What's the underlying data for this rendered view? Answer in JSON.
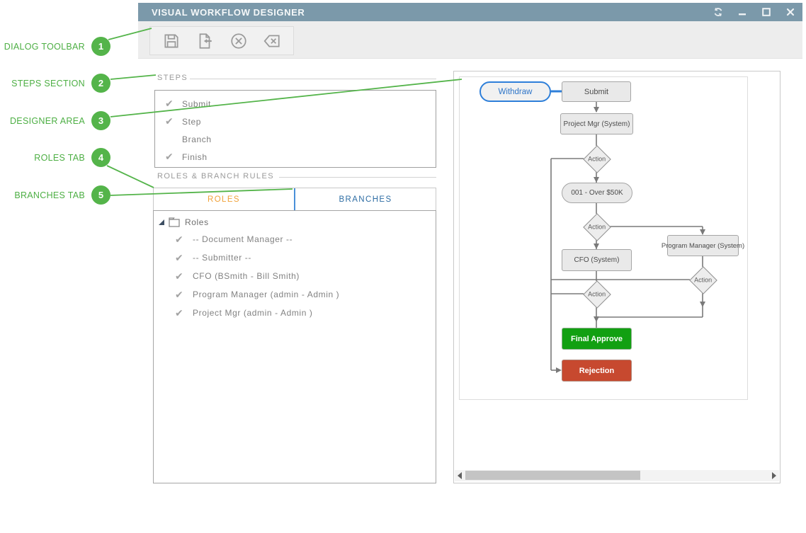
{
  "window": {
    "title": "VISUAL WORKFLOW DESIGNER",
    "controls": [
      "sync-icon",
      "minimize-icon",
      "maximize-icon",
      "close-icon"
    ]
  },
  "toolbar": {
    "icons": [
      "save-icon",
      "check-in-icon",
      "cancel-icon",
      "backspace-delete-icon"
    ]
  },
  "steps": {
    "title": "STEPS",
    "items": [
      {
        "label": "Submit",
        "checked": true
      },
      {
        "label": "Step",
        "checked": true
      },
      {
        "label": "Branch",
        "checked": false
      },
      {
        "label": "Finish",
        "checked": true
      }
    ]
  },
  "roles": {
    "title": "ROLES & BRANCH RULES",
    "tabs": {
      "roles": "ROLES",
      "branches": "BRANCHES"
    },
    "root": "Roles",
    "items": [
      {
        "label": "-- Document Manager --"
      },
      {
        "label": "-- Submitter --"
      },
      {
        "label": "CFO (BSmith - Bill Smith)"
      },
      {
        "label": "Program Manager (admin - Admin )"
      },
      {
        "label": "Project Mgr (admin - Admin )"
      }
    ]
  },
  "flow": {
    "withdraw": "Withdraw",
    "submit": "Submit",
    "project_mgr": "Project Mgr (System)",
    "action": "Action",
    "over_50k": "001 - Over $50K",
    "cfo": "CFO (System)",
    "program_manager": "Program Manager (System)",
    "final_approve": "Final Approve",
    "rejection": "Rejection"
  },
  "annotations": {
    "color": "#54b44a",
    "items": [
      {
        "n": "1",
        "label": "DIALOG TOOLBAR"
      },
      {
        "n": "2",
        "label": "STEPS SECTION"
      },
      {
        "n": "3",
        "label": "DESIGNER AREA"
      },
      {
        "n": "4",
        "label": "ROLES TAB"
      },
      {
        "n": "5",
        "label": "BRANCHES TAB"
      }
    ]
  },
  "colors": {
    "titlebar": "#7b99aa",
    "annotation_green": "#54b44a",
    "tab_roles_text": "#f0a23a",
    "tab_branches_text": "#2e6da4",
    "node_green": "#12a012",
    "node_red": "#c7492f",
    "connector_blue": "#2e7fd9"
  }
}
